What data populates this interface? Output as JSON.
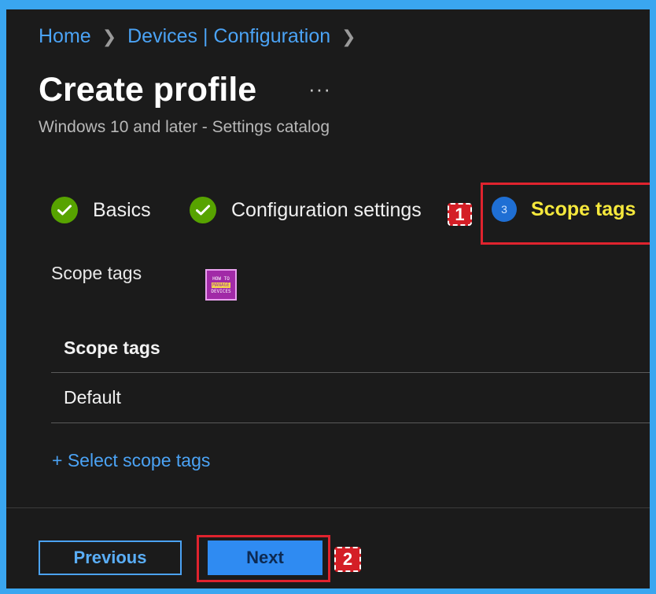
{
  "breadcrumb": {
    "items": [
      "Home",
      "Devices | Configuration"
    ]
  },
  "header": {
    "title": "Create profile",
    "more": "···",
    "subtitle": "Windows 10 and later - Settings catalog"
  },
  "steps": [
    {
      "label": "Basics",
      "status": "complete"
    },
    {
      "label": "Configuration settings",
      "status": "complete"
    },
    {
      "label": "Scope tags",
      "number": "3",
      "status": "current"
    }
  ],
  "callouts": {
    "one": "1",
    "two": "2"
  },
  "logo": {
    "top": "HOW TO",
    "mid": "MANAGE",
    "bottom": "DEVICES"
  },
  "scope": {
    "section_label": "Scope tags",
    "table_header": "Scope tags",
    "rows": [
      "Default"
    ],
    "select_link": "+ Select scope tags"
  },
  "footer": {
    "previous_label": "Previous",
    "next_label": "Next"
  },
  "colors": {
    "frame": "#3aa6f0",
    "background": "#1b1b1b",
    "accent": "#4ba3f5",
    "check": "#57a300",
    "active_step": "#f5e83c",
    "highlight": "#e0232e"
  }
}
